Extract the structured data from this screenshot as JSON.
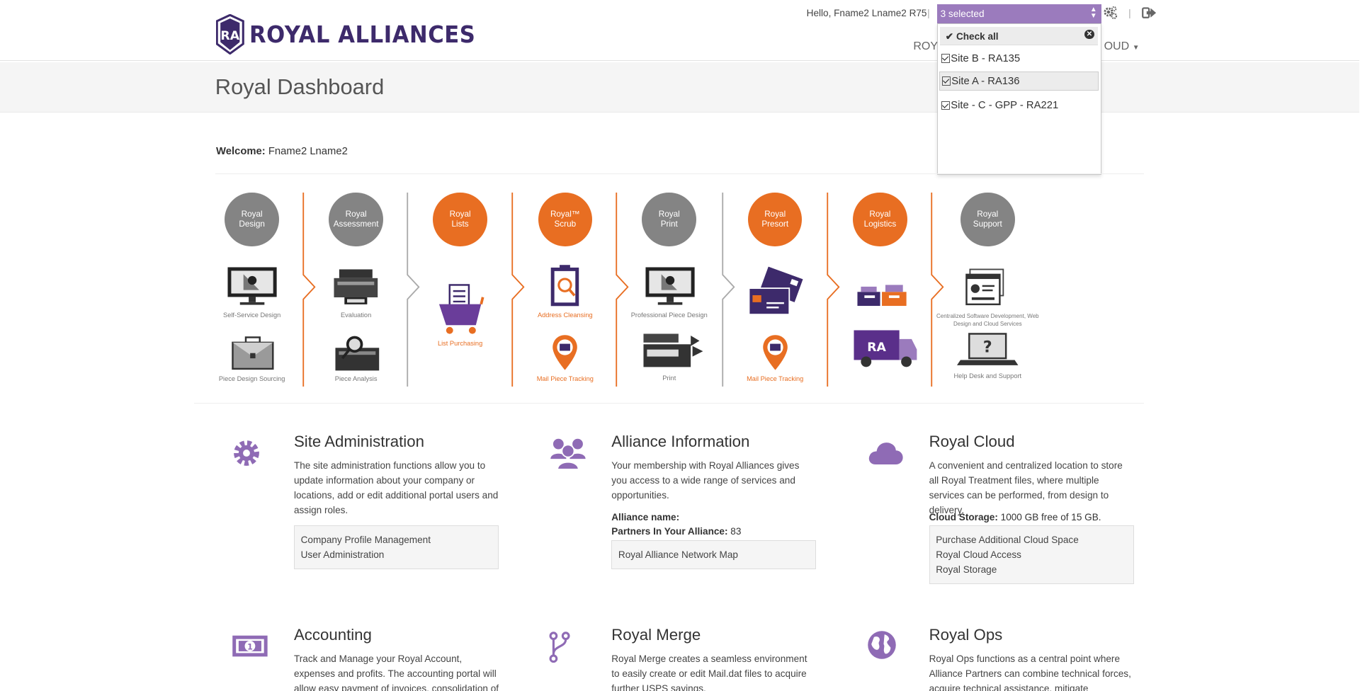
{
  "header": {
    "brand": "ROYAL ALLIANCES",
    "greeting": "Hello, Fname2 Lname2 R75",
    "nav_left": "ROYA",
    "nav_right": "OUD"
  },
  "site_selector": {
    "summary": "3 selected",
    "check_all": "Check all",
    "options": [
      {
        "label": "Site B - RA135",
        "checked": true
      },
      {
        "label": "Site A - RA136",
        "checked": true
      },
      {
        "label": "Site - C - GPP - RA221",
        "checked": true
      }
    ]
  },
  "page": {
    "title": "Royal Dashboard",
    "welcome_label": "Welcome:",
    "welcome_name": "Fname2 Lname2"
  },
  "colors": {
    "accent_purple": "#9b7bbd",
    "brand_purple": "#3d2a6b",
    "orange": "#e86e22",
    "gray": "#848484"
  },
  "process": [
    {
      "line1": "Royal",
      "line2": "Design",
      "color": "gray",
      "items": [
        "Self-Service Design",
        "Piece Design Sourcing"
      ]
    },
    {
      "line1": "Royal",
      "line2": "Assessment",
      "color": "gray",
      "items": [
        "Evaluation",
        "Piece Analysis"
      ]
    },
    {
      "line1": "Royal",
      "line2": "Lists",
      "color": "orange",
      "items": [
        "List Purchasing"
      ]
    },
    {
      "line1": "Royal™",
      "line2": "Scrub",
      "color": "orange",
      "items": [
        "Address Cleansing",
        "Mail Piece Tracking"
      ]
    },
    {
      "line1": "Royal",
      "line2": "Print",
      "color": "gray",
      "items": [
        "Professional Piece Design",
        "Print"
      ]
    },
    {
      "line1": "Royal",
      "line2": "Presort",
      "color": "orange",
      "items": [
        "Mail Piece Tracking"
      ]
    },
    {
      "line1": "Royal",
      "line2": "Logistics",
      "color": "orange",
      "items": []
    },
    {
      "line1": "Royal",
      "line2": "Support",
      "color": "gray",
      "items": [
        "Centralized Software Development, Web Design and Cloud Services",
        "Help Desk and Support"
      ]
    }
  ],
  "sections": {
    "site_admin": {
      "title": "Site Administration",
      "desc": "The site administration functions allow you to update information about your company or locations, add or edit additional portal users and assign roles.",
      "links": [
        "Company Profile Management",
        "User Administration"
      ]
    },
    "alliance": {
      "title": "Alliance Information",
      "desc": "Your membership with Royal Alliances gives you access to a wide range of services and opportunities.",
      "name_label": "Alliance name:",
      "name_value": "",
      "partners_label": "Partners In Your Alliance:",
      "partners_value": "83",
      "links": [
        "Royal Alliance Network Map"
      ]
    },
    "cloud": {
      "title": "Royal Cloud",
      "desc": "A convenient and centralized location to store all Royal Treatment files, where multiple services can be performed, from design to delivery.",
      "storage_label": "Cloud Storage:",
      "storage_value": "1000 GB free of 15 GB.",
      "links": [
        "Purchase Additional Cloud Space",
        "Royal Cloud Access",
        "Royal Storage"
      ]
    },
    "accounting": {
      "title": "Accounting",
      "desc": "Track and Manage your Royal Account, expenses and profits. The accounting portal will allow easy payment of invoices, consolidation of"
    },
    "merge": {
      "title": "Royal Merge",
      "desc": "Royal Merge creates a seamless environment to easily create or edit Mail.dat files to acquire further USPS savings."
    },
    "ops": {
      "title": "Royal Ops",
      "desc": "Royal Ops functions as a central point where Alliance Partners can combine technical forces, acquire technical assistance, mitigate"
    }
  }
}
